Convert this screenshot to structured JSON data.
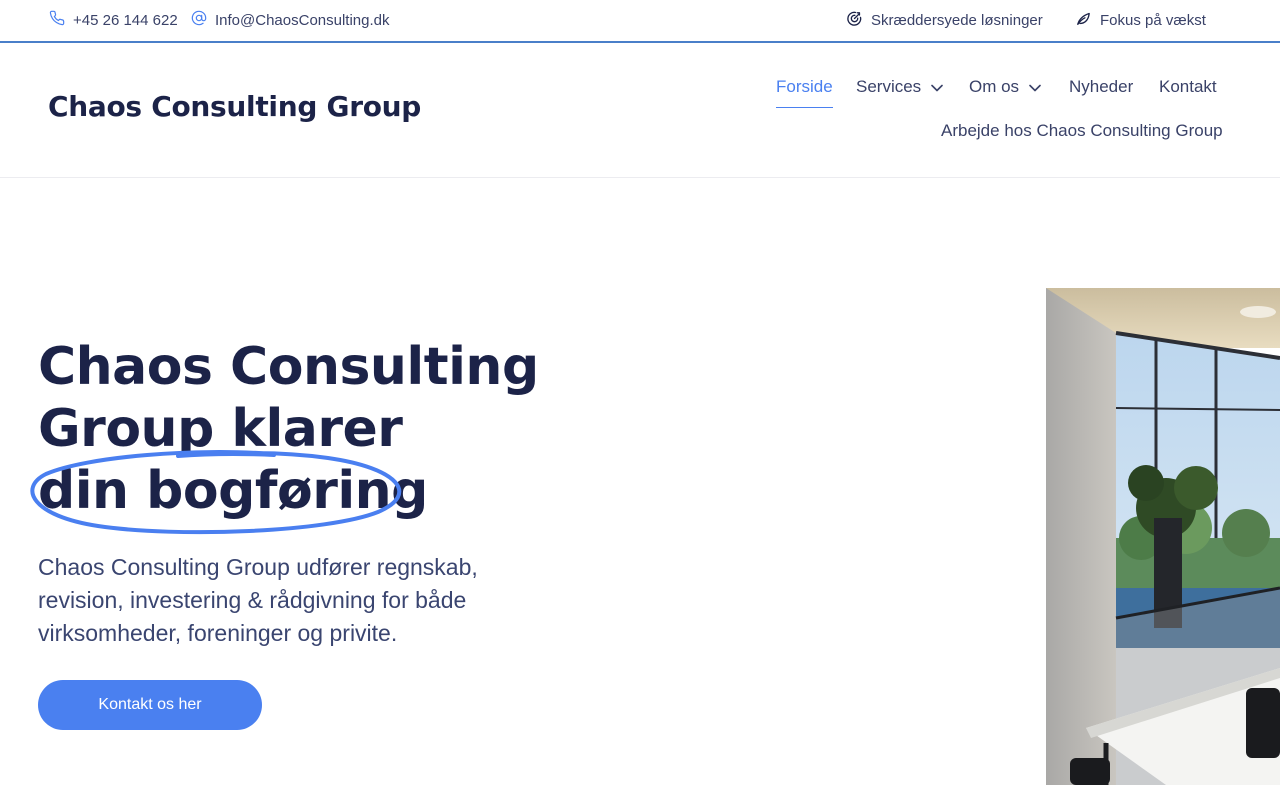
{
  "topbar": {
    "phone": "+45 26 144 622",
    "email": "Info@ChaosConsulting.dk",
    "feature_1": "Skræddersyede løsninger",
    "feature_2": "Fokus på vækst"
  },
  "header": {
    "brand": "Chaos Consulting Group",
    "nav": {
      "home": "Forside",
      "services": "Services",
      "about": "Om os",
      "news": "Nyheder",
      "contact": "Kontakt",
      "careers": "Arbejde hos Chaos Consulting Group"
    },
    "active_item": "Forside"
  },
  "hero": {
    "title_line_1": "Chaos Consulting",
    "title_line_2": "Group klarer",
    "title_line_3": "din bogføring",
    "subtitle": "Chaos Consulting Group udfører regnskab, revision, investering & rådgivning for både virksomheder, foreninger og privite.",
    "cta_label": "Kontakt os her"
  },
  "icons": {
    "phone": "phone-icon",
    "email": "at-sign-icon",
    "tailored": "target-icon",
    "growth": "leaf-icon",
    "dropdown": "chevron-down-icon"
  },
  "colors": {
    "accent": "#4a80f0",
    "heading": "#1c2348",
    "text": "#3a4268",
    "topbar_border": "#4a7fc9"
  }
}
